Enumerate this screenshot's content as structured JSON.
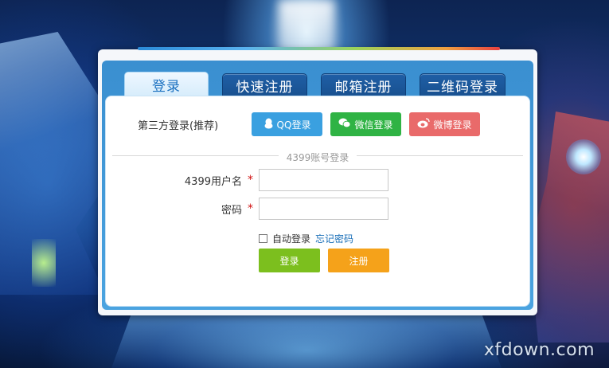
{
  "tabs": [
    {
      "label": "登录",
      "active": true
    },
    {
      "label": "快速注册",
      "active": false
    },
    {
      "label": "邮箱注册",
      "active": false
    },
    {
      "label": "二维码登录",
      "active": false
    }
  ],
  "third_party": {
    "label": "第三方登录(推荐)",
    "qq": {
      "label": "QQ登录",
      "icon": "qq-penguin-icon",
      "color": "#3aa0e0"
    },
    "wechat": {
      "label": "微信登录",
      "icon": "wechat-icon",
      "color": "#2fb344"
    },
    "weibo": {
      "label": "微博登录",
      "icon": "weibo-icon",
      "color": "#e96a6a"
    }
  },
  "account_section": {
    "label": "4399账号登录"
  },
  "form": {
    "username_label": "4399用户名",
    "username_value": "",
    "password_label": "密码",
    "password_value": "",
    "required_mark": "*",
    "auto_login_label": "自动登录",
    "auto_login_checked": false,
    "forgot_password": "忘记密码",
    "login_button": "登录",
    "register_button": "注册"
  },
  "colors": {
    "login_button": "#7cbf1e",
    "register_button": "#f5a21a",
    "tab_active_text": "#1a70c0",
    "frame": "#3a8fd0"
  },
  "watermark": "xfdown.com"
}
